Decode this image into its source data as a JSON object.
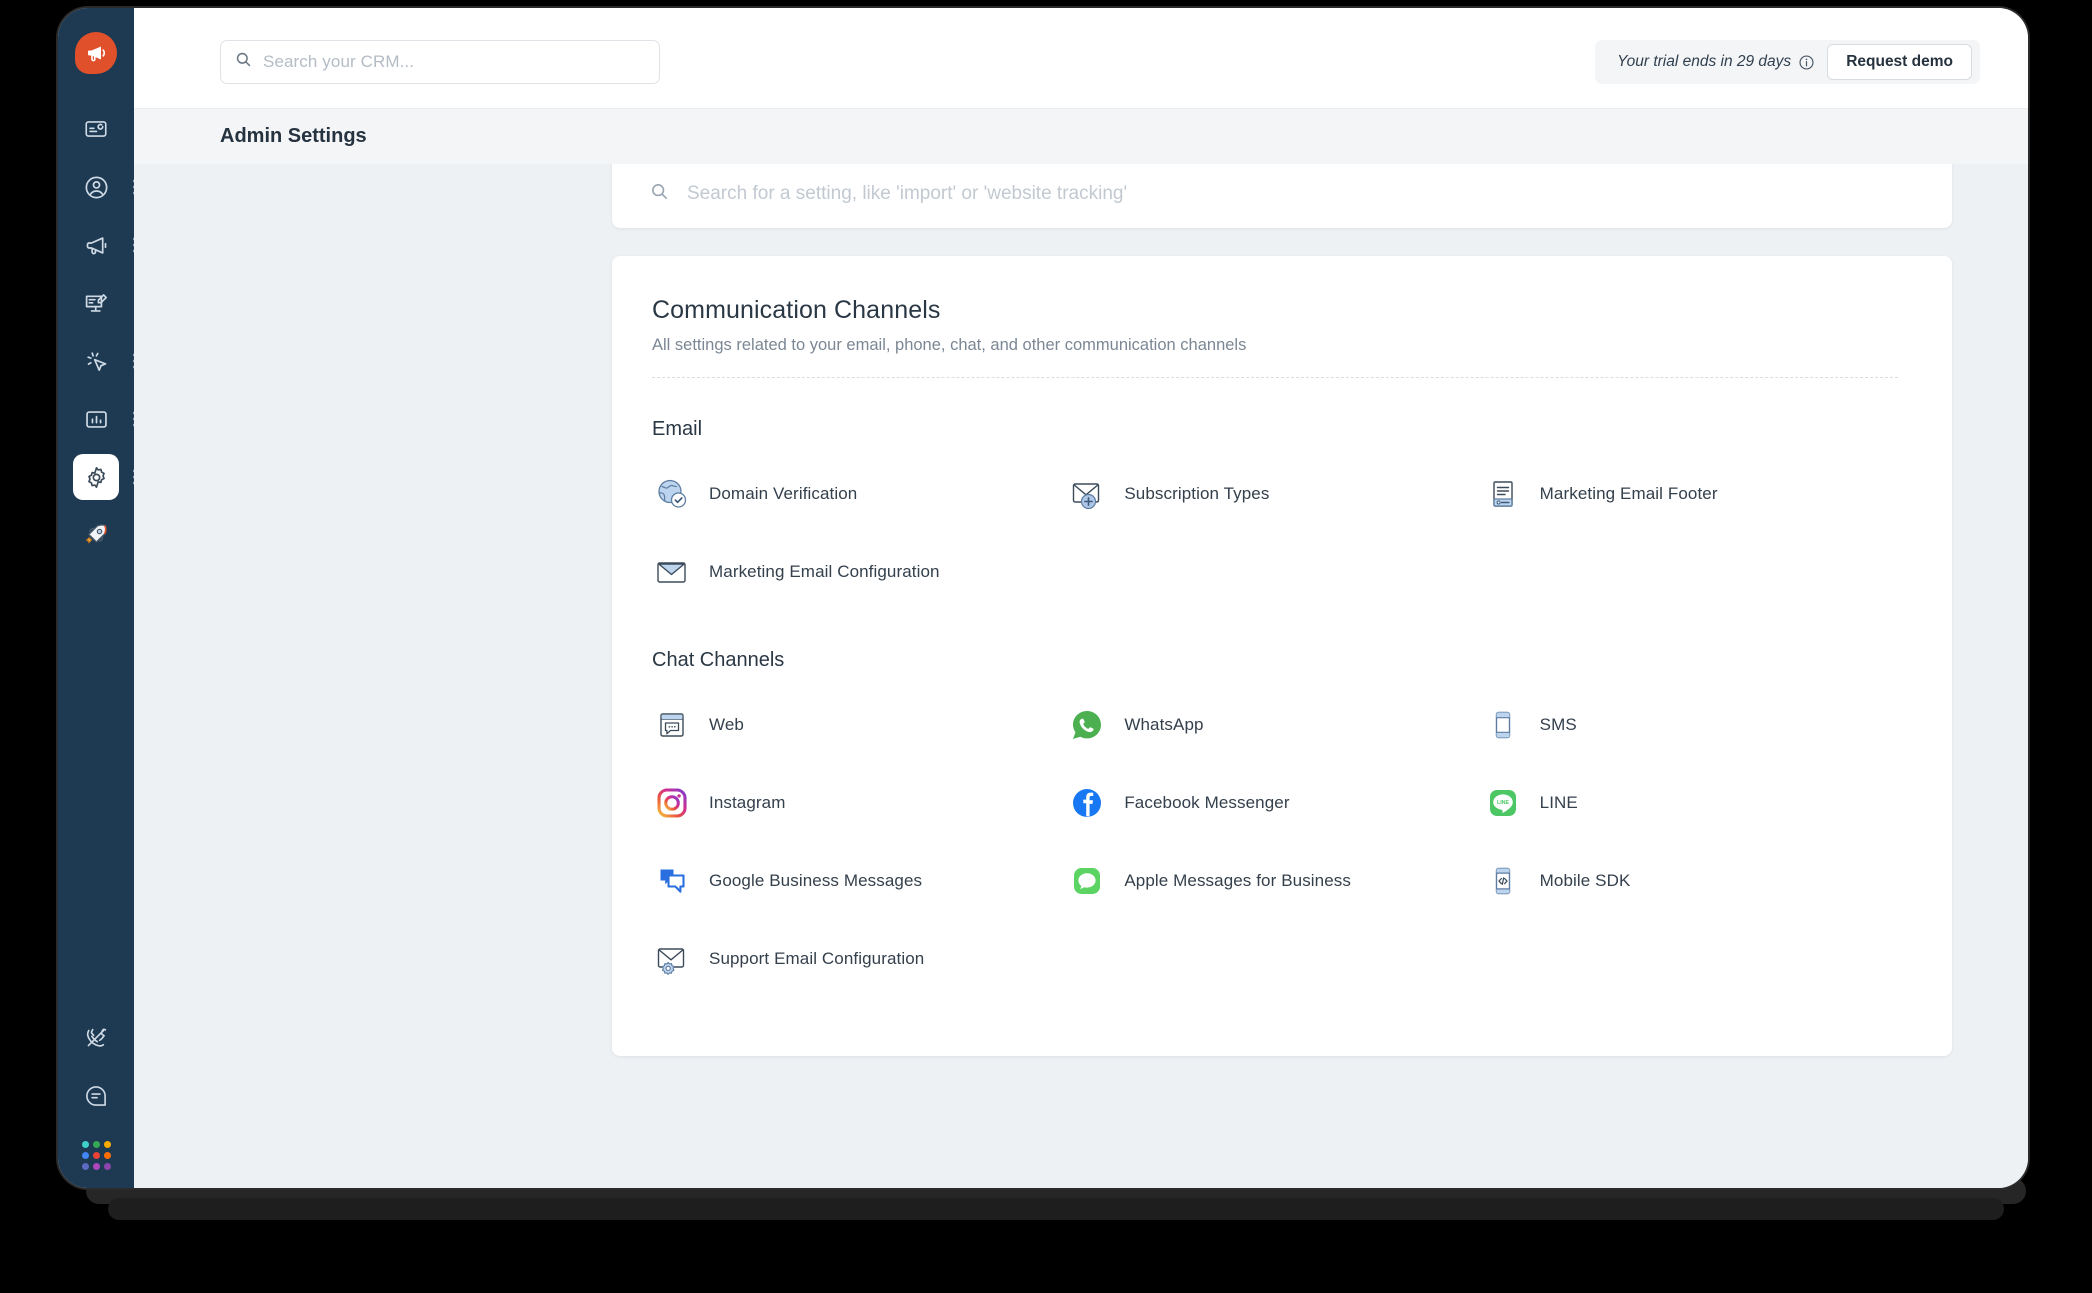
{
  "app": {
    "logo_icon": "megaphone-logo-icon",
    "accent_color": "#e0512b",
    "rail_color": "#1e3a53"
  },
  "topbar": {
    "crm_search": {
      "icon": "search-icon",
      "value": "",
      "placeholder": "Search your CRM..."
    },
    "trial_notice": "Your trial ends in 29 days",
    "trial_info_icon": "info-circle-icon",
    "request_demo_label": "Request demo"
  },
  "page": {
    "title": "Admin Settings"
  },
  "settings_search": {
    "icon": "search-icon",
    "value": "",
    "placeholder": "Search for a setting, like 'import' or 'website tracking'"
  },
  "panel": {
    "title": "Communication Channels",
    "subtitle": "All settings related to your email, phone, chat, and other communication channels",
    "groups": [
      {
        "title": "Email",
        "items": [
          {
            "label": "Domain Verification",
            "icon": "globe-check-icon"
          },
          {
            "label": "Subscription Types",
            "icon": "envelope-plus-icon"
          },
          {
            "label": "Marketing Email Footer",
            "icon": "document-footer-icon"
          },
          {
            "label": "Marketing Email Configuration",
            "icon": "envelope-icon"
          }
        ]
      },
      {
        "title": "Chat Channels",
        "items": [
          {
            "label": "Web",
            "icon": "browser-chat-icon"
          },
          {
            "label": "WhatsApp",
            "icon": "whatsapp-icon"
          },
          {
            "label": "SMS",
            "icon": "mobile-sms-icon"
          },
          {
            "label": "Instagram",
            "icon": "instagram-icon"
          },
          {
            "label": "Facebook Messenger",
            "icon": "facebook-icon"
          },
          {
            "label": "LINE",
            "icon": "line-icon"
          },
          {
            "label": "Google Business Messages",
            "icon": "google-business-messages-icon"
          },
          {
            "label": "Apple Messages for Business",
            "icon": "apple-messages-icon"
          },
          {
            "label": "Mobile SDK",
            "icon": "mobile-code-icon"
          },
          {
            "label": "Support Email Configuration",
            "icon": "envelope-gear-icon"
          }
        ]
      }
    ]
  },
  "sidebar": {
    "items": [
      {
        "name": "activity-card",
        "icon": "card-activity-icon",
        "has_menu": false
      },
      {
        "name": "contacts",
        "icon": "user-circle-icon",
        "has_menu": true
      },
      {
        "name": "marketing",
        "icon": "megaphone-icon",
        "has_menu": true
      },
      {
        "name": "content",
        "icon": "monitor-edit-icon",
        "has_menu": false
      },
      {
        "name": "automation",
        "icon": "cursor-click-icon",
        "has_menu": true
      },
      {
        "name": "reports",
        "icon": "bar-chart-icon",
        "has_menu": true
      },
      {
        "name": "settings",
        "icon": "gear-icon",
        "has_menu": true,
        "active": true
      },
      {
        "name": "onboarding",
        "icon": "rocket-icon",
        "has_menu": false
      }
    ],
    "bottom_items": [
      {
        "name": "phone-off",
        "icon": "phone-off-icon"
      },
      {
        "name": "chat",
        "icon": "chat-bubble-icon"
      },
      {
        "name": "apps",
        "icon": "apps-grid-icon"
      }
    ],
    "apps_grid_colors": [
      "#3fd0c9",
      "#34a853",
      "#f9ab00",
      "#4285f4",
      "#ea4335",
      "#ff6d00",
      "#5c6bc0",
      "#ab47bc",
      "#8e44ad"
    ]
  }
}
